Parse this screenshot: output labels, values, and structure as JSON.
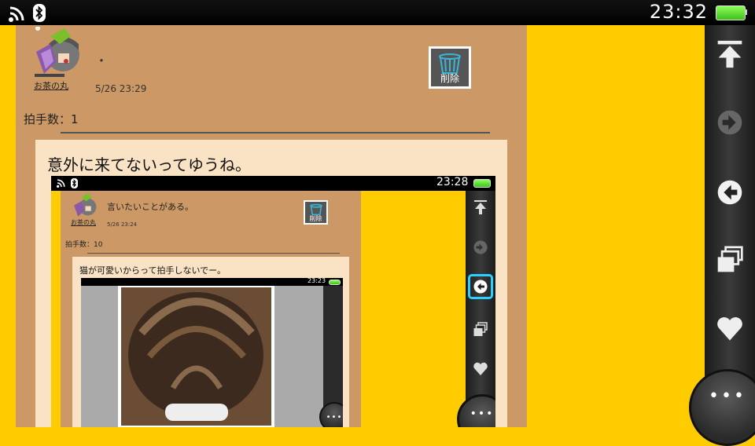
{
  "status": {
    "clock": "23:32"
  },
  "post": {
    "user_name": "お茶の丸",
    "message": "・",
    "timestamp": "5/26 23:29",
    "delete_label": "削除",
    "applause": "拍手数：1",
    "comment": "意外に来てないってゆうね。"
  },
  "nested": {
    "clock": "23:28",
    "user_name": "お茶の丸",
    "message": "言いたいことがある。",
    "timestamp": "5/26 23:24",
    "delete_label": "削除",
    "applause": "拍手数：10",
    "comment": "猫が可愛いからって拍手しないでー。",
    "inner_clock": "23:23"
  },
  "toolbar": {
    "items": [
      "scroll-top",
      "forward",
      "back",
      "windows",
      "favorite"
    ],
    "more": "more"
  },
  "colors": {
    "background": "#ffcc00",
    "panel": "#cc9966",
    "card": "#f9e3c4",
    "toolbar": "#2a2a2a"
  }
}
